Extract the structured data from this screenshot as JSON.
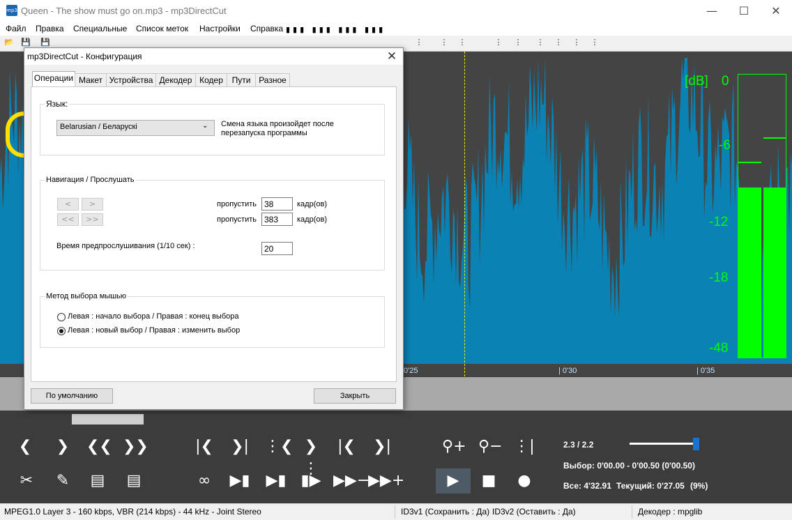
{
  "window": {
    "title": "Queen - The show must go on.mp3 - mp3DirectCut",
    "app_icon_text": "mp3"
  },
  "menu": [
    "Файл",
    "Правка",
    "Специальные",
    "Список меток",
    "Настройки",
    "Справка"
  ],
  "timeline": {
    "labels": [
      "0'25",
      "0'30",
      "0'35"
    ]
  },
  "vu": {
    "unit_label": "[dB]",
    "scale": [
      "0",
      "-6",
      "-12",
      "-18",
      "-48"
    ],
    "color": "#00ff00",
    "level_left": 0.6,
    "level_right": 0.6
  },
  "wave": {
    "color": "#0a82b4",
    "background": "#444444",
    "cursor_color": "#f0f000"
  },
  "playback": {
    "zoom": "2.3  /  2.2",
    "volume_fraction": 0.95,
    "selection": "Выбор: 0'00.00 - 0'00.50 (0'00.50)",
    "total": "Все: 4'32.91",
    "current": "Текущий: 0'27.05",
    "percent": "(9%)"
  },
  "status": {
    "format": "MPEG1.0 Layer 3 - 160 kbps, VBR (214 kbps) - 44 kHz - Joint Stereo",
    "id3v1": "ID3v1 (Сохранить : Да)",
    "id3v2": "ID3v2 (Оставить : Да)",
    "decoder": "Декодер : mpglib"
  },
  "dialog": {
    "title": "mp3DirectCut - Конфигурация",
    "tabs": [
      "Операции",
      "Макет",
      "Устройства",
      "Декодер",
      "Кодер",
      "Пути",
      "Разное"
    ],
    "language": {
      "group_label": "Язык:",
      "selected": "Belarusian  /  Беларускі",
      "note_line1": "Смена языка произойдет после",
      "note_line2": "перезапуска программы"
    },
    "navigation": {
      "group_label": "Навигация / Прослушать",
      "btn_prev": "<",
      "btn_next": ">",
      "btn_prev_big": "<<",
      "btn_next_big": ">>",
      "skip_label": "пропустить",
      "skip_small": "38",
      "skip_big": "383",
      "frames_label": "кадр(ов)",
      "preview_label": "Время предпрослушивания (1/10 сек) :",
      "preview_value": "20"
    },
    "mouse": {
      "group_label": "Метод выбора мышью",
      "option1": "Левая : начало выбора / Правая : конец выбора",
      "option2": "Левая : новый выбор / Правая : изменить выбор",
      "selected_index": 1
    },
    "defaults_button": "По умолчанию",
    "close_button": "Закрыть"
  }
}
